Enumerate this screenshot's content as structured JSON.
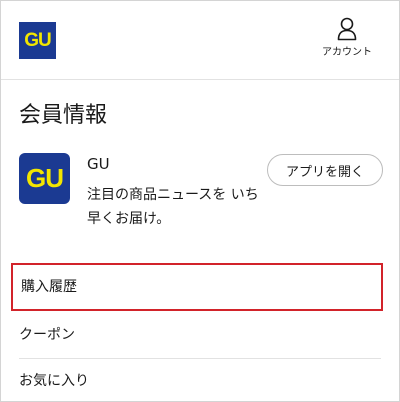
{
  "header": {
    "logo_text": "GU",
    "account_label": "アカウント",
    "account_icon": "person-icon"
  },
  "page": {
    "title": "会員情報"
  },
  "app_promo": {
    "icon_text": "GU",
    "name": "GU",
    "description": "注目の商品ニュースを いち早くお届け。",
    "open_button_label": "アプリを開く"
  },
  "menu": {
    "items": [
      {
        "label": "購入履歴",
        "highlighted": true
      },
      {
        "label": "クーポン"
      },
      {
        "label": "お気に入り"
      }
    ]
  },
  "colors": {
    "brand_blue": "#1b3a92",
    "brand_yellow": "#f2e600",
    "highlight_red": "#d2232a"
  }
}
